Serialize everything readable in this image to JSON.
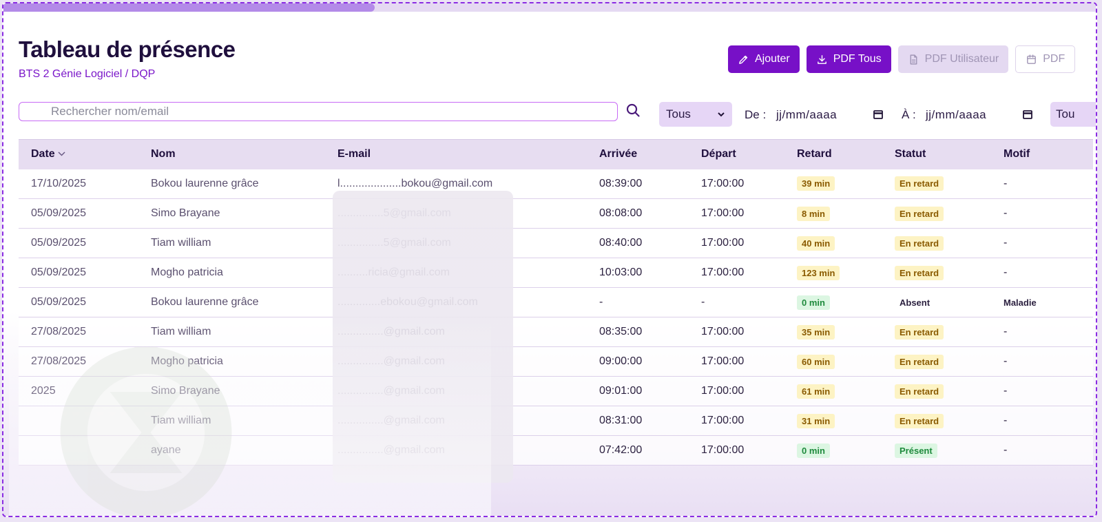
{
  "page": {
    "title": "Tableau de présence",
    "subtitle": "BTS 2 Génie Logiciel / DQP"
  },
  "actions": {
    "add_label": "Ajouter",
    "pdf_all_label": "PDF Tous",
    "pdf_user_label": "PDF Utilisateur",
    "pdf_date_label": "PDF"
  },
  "filters": {
    "search_placeholder": "Rechercher nom/email",
    "status_selected": "Tous",
    "from_label": "De :",
    "from_value": "jj/mm/aaaa",
    "to_label": "À :",
    "to_value": "jj/mm/aaaa",
    "extra_selected": "Tou"
  },
  "table": {
    "headers": [
      "Date",
      "Nom",
      "E-mail",
      "Arrivée",
      "Départ",
      "Retard",
      "Statut",
      "Motif"
    ],
    "rows": [
      {
        "date": "17/10/2025",
        "nom": "Bokou laurenne grâce",
        "email": "l....................bokou@gmail.com",
        "arrivee": "08:39:00",
        "depart": "17:00:00",
        "retard": "39 min",
        "statut": "En retard",
        "motif": "-"
      },
      {
        "date": "05/09/2025",
        "nom": "Simo Brayane",
        "email": "...............5@gmail.com",
        "arrivee": "08:08:00",
        "depart": "17:00:00",
        "retard": "8 min",
        "statut": "En retard",
        "motif": "-"
      },
      {
        "date": "05/09/2025",
        "nom": "Tiam william",
        "email": "...............5@gmail.com",
        "arrivee": "08:40:00",
        "depart": "17:00:00",
        "retard": "40 min",
        "statut": "En retard",
        "motif": "-"
      },
      {
        "date": "05/09/2025",
        "nom": "Mogho patricia",
        "email": "..........ricia@gmail.com",
        "arrivee": "10:03:00",
        "depart": "17:00:00",
        "retard": "123 min",
        "statut": "En retard",
        "motif": "-"
      },
      {
        "date": "05/09/2025",
        "nom": "Bokou laurenne grâce",
        "email": "..............ebokou@gmail.com",
        "arrivee": "-",
        "depart": "-",
        "retard": "0 min",
        "statut": "Absent",
        "motif": "Maladie"
      },
      {
        "date": "27/08/2025",
        "nom": "Tiam william",
        "email": "...............@gmail.com",
        "arrivee": "08:35:00",
        "depart": "17:00:00",
        "retard": "35 min",
        "statut": "En retard",
        "motif": "-"
      },
      {
        "date": "27/08/2025",
        "nom": "Mogho patricia",
        "email": "...............@gmail.com",
        "arrivee": "09:00:00",
        "depart": "17:00:00",
        "retard": "60 min",
        "statut": "En retard",
        "motif": "-"
      },
      {
        "date": "2025",
        "nom": "Simo Brayane",
        "email": "...............@gmail.com",
        "arrivee": "09:01:00",
        "depart": "17:00:00",
        "retard": "61 min",
        "statut": "En retard",
        "motif": "-"
      },
      {
        "date": "",
        "nom": "Tiam william",
        "email": "...............@gmail.com",
        "arrivee": "08:31:00",
        "depart": "17:00:00",
        "retard": "31 min",
        "statut": "En retard",
        "motif": "-"
      },
      {
        "date": "",
        "nom": "ayane",
        "email": "...............@gmail.com",
        "arrivee": "07:42:00",
        "depart": "17:00:00",
        "retard": "0 min",
        "statut": "Présent",
        "motif": "-"
      }
    ]
  },
  "colors": {
    "accent": "#7710c7",
    "late_badge": "#fdf3c4",
    "ok_badge": "#dcf6e2"
  },
  "progress": {
    "fraction": 0.34
  }
}
